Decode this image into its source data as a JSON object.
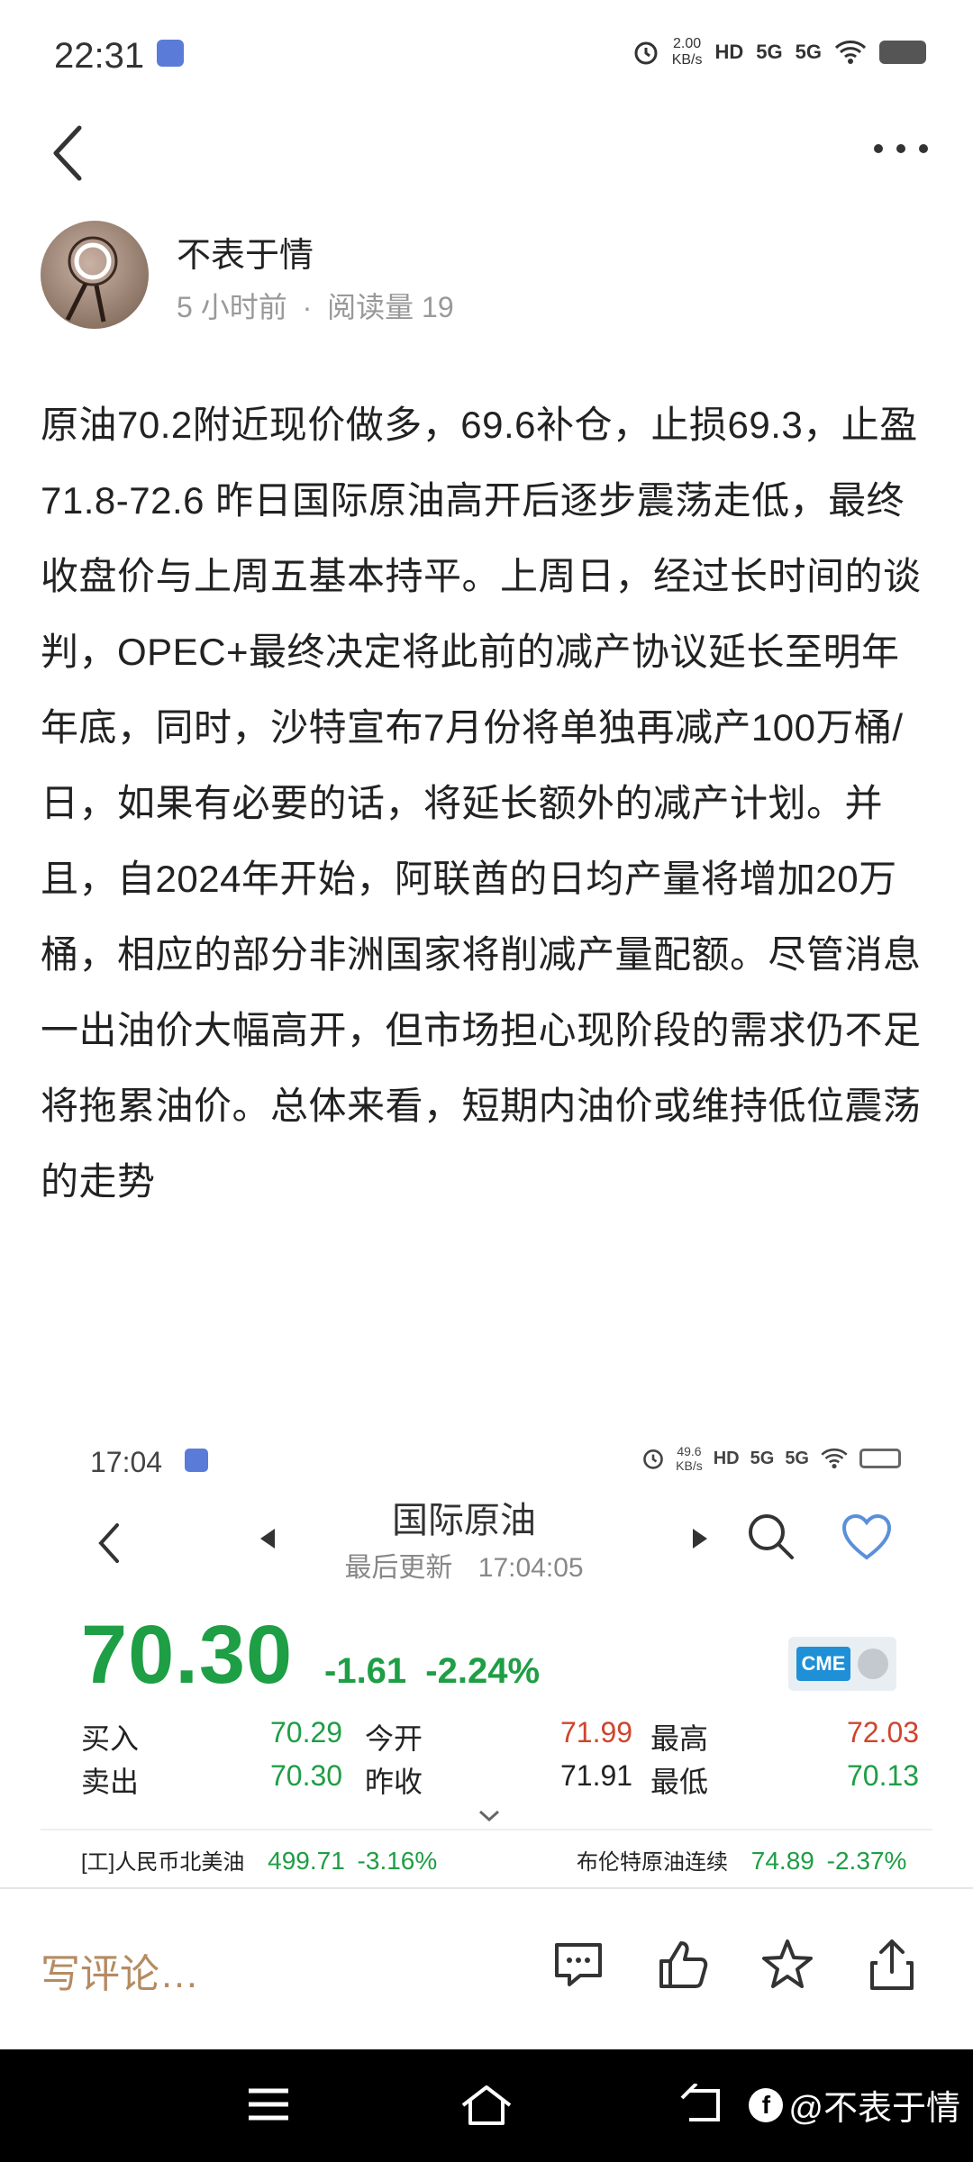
{
  "status_bar": {
    "time": "22:31",
    "net_speed_value": "2.00",
    "net_speed_unit": "KB/s",
    "hd": "HD",
    "signal_1": "5G",
    "signal_2": "5G"
  },
  "author": {
    "name": "不表于情",
    "time_ago": "5 小时前",
    "separator": "·",
    "read_count": "阅读量 19"
  },
  "article": {
    "text": "原油70.2附近现价做多，69.6补仓，止损69.3，止盈71.8-72.6 昨日国际原油高开后逐步震荡走低，最终收盘价与上周五基本持平。上周日，经过长时间的谈判，OPEC+最终决定将此前的减产协议延长至明年年底，同时，沙特宣布7月份将单独再减产100万桶/日，如果有必要的话，将延长额外的减产计划。并且，自2024年开始，阿联酋的日均产量将增加20万桶，相应的部分非洲国家将削减产量配额。尽管消息一出油价大幅高开，但市场担心现阶段的需求仍不足将拖累油价。总体来看，短期内油价或维持低位震荡的走势"
  },
  "embed": {
    "status_time": "17:04",
    "net_speed_value": "49.6",
    "net_speed_unit": "KB/s",
    "hd": "HD",
    "signal_1": "5G",
    "signal_2": "5G",
    "title": "国际原油",
    "last_updated_label": "最后更新",
    "last_updated_time": "17:04:05",
    "price": "70.30",
    "change": "-1.61",
    "change_pct": "-2.24%",
    "exchange_badge": "CME",
    "quotes": {
      "buy_label": "买入",
      "buy_value": "70.29",
      "open_label": "今开",
      "open_value": "71.99",
      "high_label": "最高",
      "high_value": "72.03",
      "sell_label": "卖出",
      "sell_value": "70.30",
      "prev_close_label": "昨收",
      "prev_close_value": "71.91",
      "low_label": "最低",
      "low_value": "70.13"
    },
    "tickers": [
      {
        "name": "[工]人民币北美油",
        "price": "499.71",
        "pct": "-3.16%"
      },
      {
        "name": "布伦特原油连续",
        "price": "74.89",
        "pct": "-2.37%"
      }
    ]
  },
  "action_bar": {
    "comment_placeholder": "写评论…"
  },
  "watermark": {
    "handle": "@不表于情",
    "logo_letter": "f"
  },
  "colors": {
    "up_red": "#d0442e",
    "down_green": "#1e9e45",
    "comment_placeholder": "#b58b62",
    "heart_blue": "#5b8fd9"
  }
}
